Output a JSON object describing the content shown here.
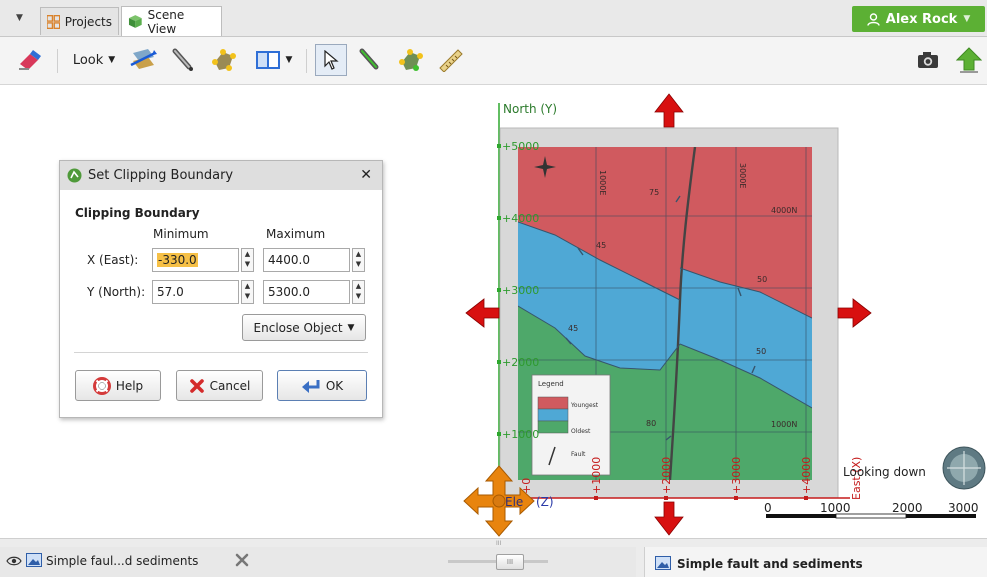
{
  "tabs": {
    "menu_arrow": "▼",
    "projects": "Projects",
    "scene_view": "Scene View"
  },
  "user": {
    "name": "Alex Rock",
    "dropdown": "▼"
  },
  "toolbar": {
    "look_label": "Look",
    "look_arrow": "▼",
    "split_arrow": "▼"
  },
  "scene": {
    "north_label": "North (Y)",
    "east_label": "East (X)",
    "z_label": "(Z)",
    "elev_label": "Ele",
    "looking": "Looking down",
    "north_ticks": [
      "+5000",
      "+4000",
      "+3000",
      "+2000",
      "+1000"
    ],
    "east_ticks": [
      "+0",
      "+1000",
      "+2000",
      "+3000",
      "+4000"
    ],
    "map_labels": {
      "e1000": "1000E",
      "e3000": "3000E",
      "n4000": "4000N",
      "n1000": "1000N",
      "dip75": "75",
      "dip45a": "45",
      "dip45b": "45",
      "dip50a": "50",
      "dip50b": "50",
      "dip80": "80"
    },
    "legend": {
      "title": "Legend",
      "youngest": "Youngest",
      "oldest": "Oldest",
      "fault": "Fault"
    },
    "scale": [
      "0",
      "1000",
      "2000",
      "3000"
    ],
    "colors": {
      "red_unit": "#d05a5f",
      "blue_unit": "#4fa8d5",
      "green_unit": "#4ea86a",
      "axis_green": "#2ea82e",
      "arrow_red": "#d81010",
      "widget_orange": "#e8840e"
    }
  },
  "dialog": {
    "title": "Set Clipping Boundary",
    "close": "✕",
    "section": "Clipping Boundary",
    "col_min": "Minimum",
    "col_max": "Maximum",
    "row_x": "X (East):",
    "row_y": "Y (North):",
    "x_min": "-330.0",
    "x_max": "4400.0",
    "y_min": "57.0",
    "y_max": "5300.0",
    "spin_up": "▲",
    "spin_down": "▼",
    "enclose": "Enclose Object",
    "enclose_arrow": "▼",
    "help": "Help",
    "cancel": "Cancel",
    "ok": "OK"
  },
  "bottom": {
    "left_title": "Simple faul...d sediments",
    "right_title": "Simple fault and sediments",
    "splitter": "III"
  }
}
